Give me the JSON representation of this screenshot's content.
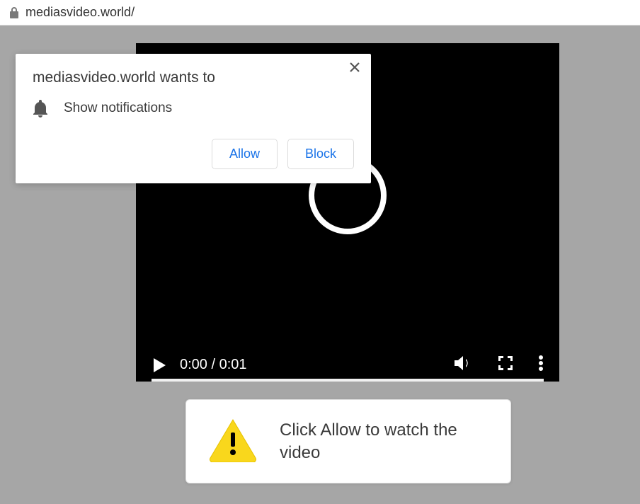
{
  "address_bar": {
    "url": "mediasvideo.world/"
  },
  "permission_popup": {
    "title": "mediasvideo.world wants to",
    "permission_label": "Show notifications",
    "allow_label": "Allow",
    "block_label": "Block"
  },
  "video": {
    "time_display": "0:00 / 0:01"
  },
  "hint": {
    "text": "Click Allow to watch the video"
  }
}
